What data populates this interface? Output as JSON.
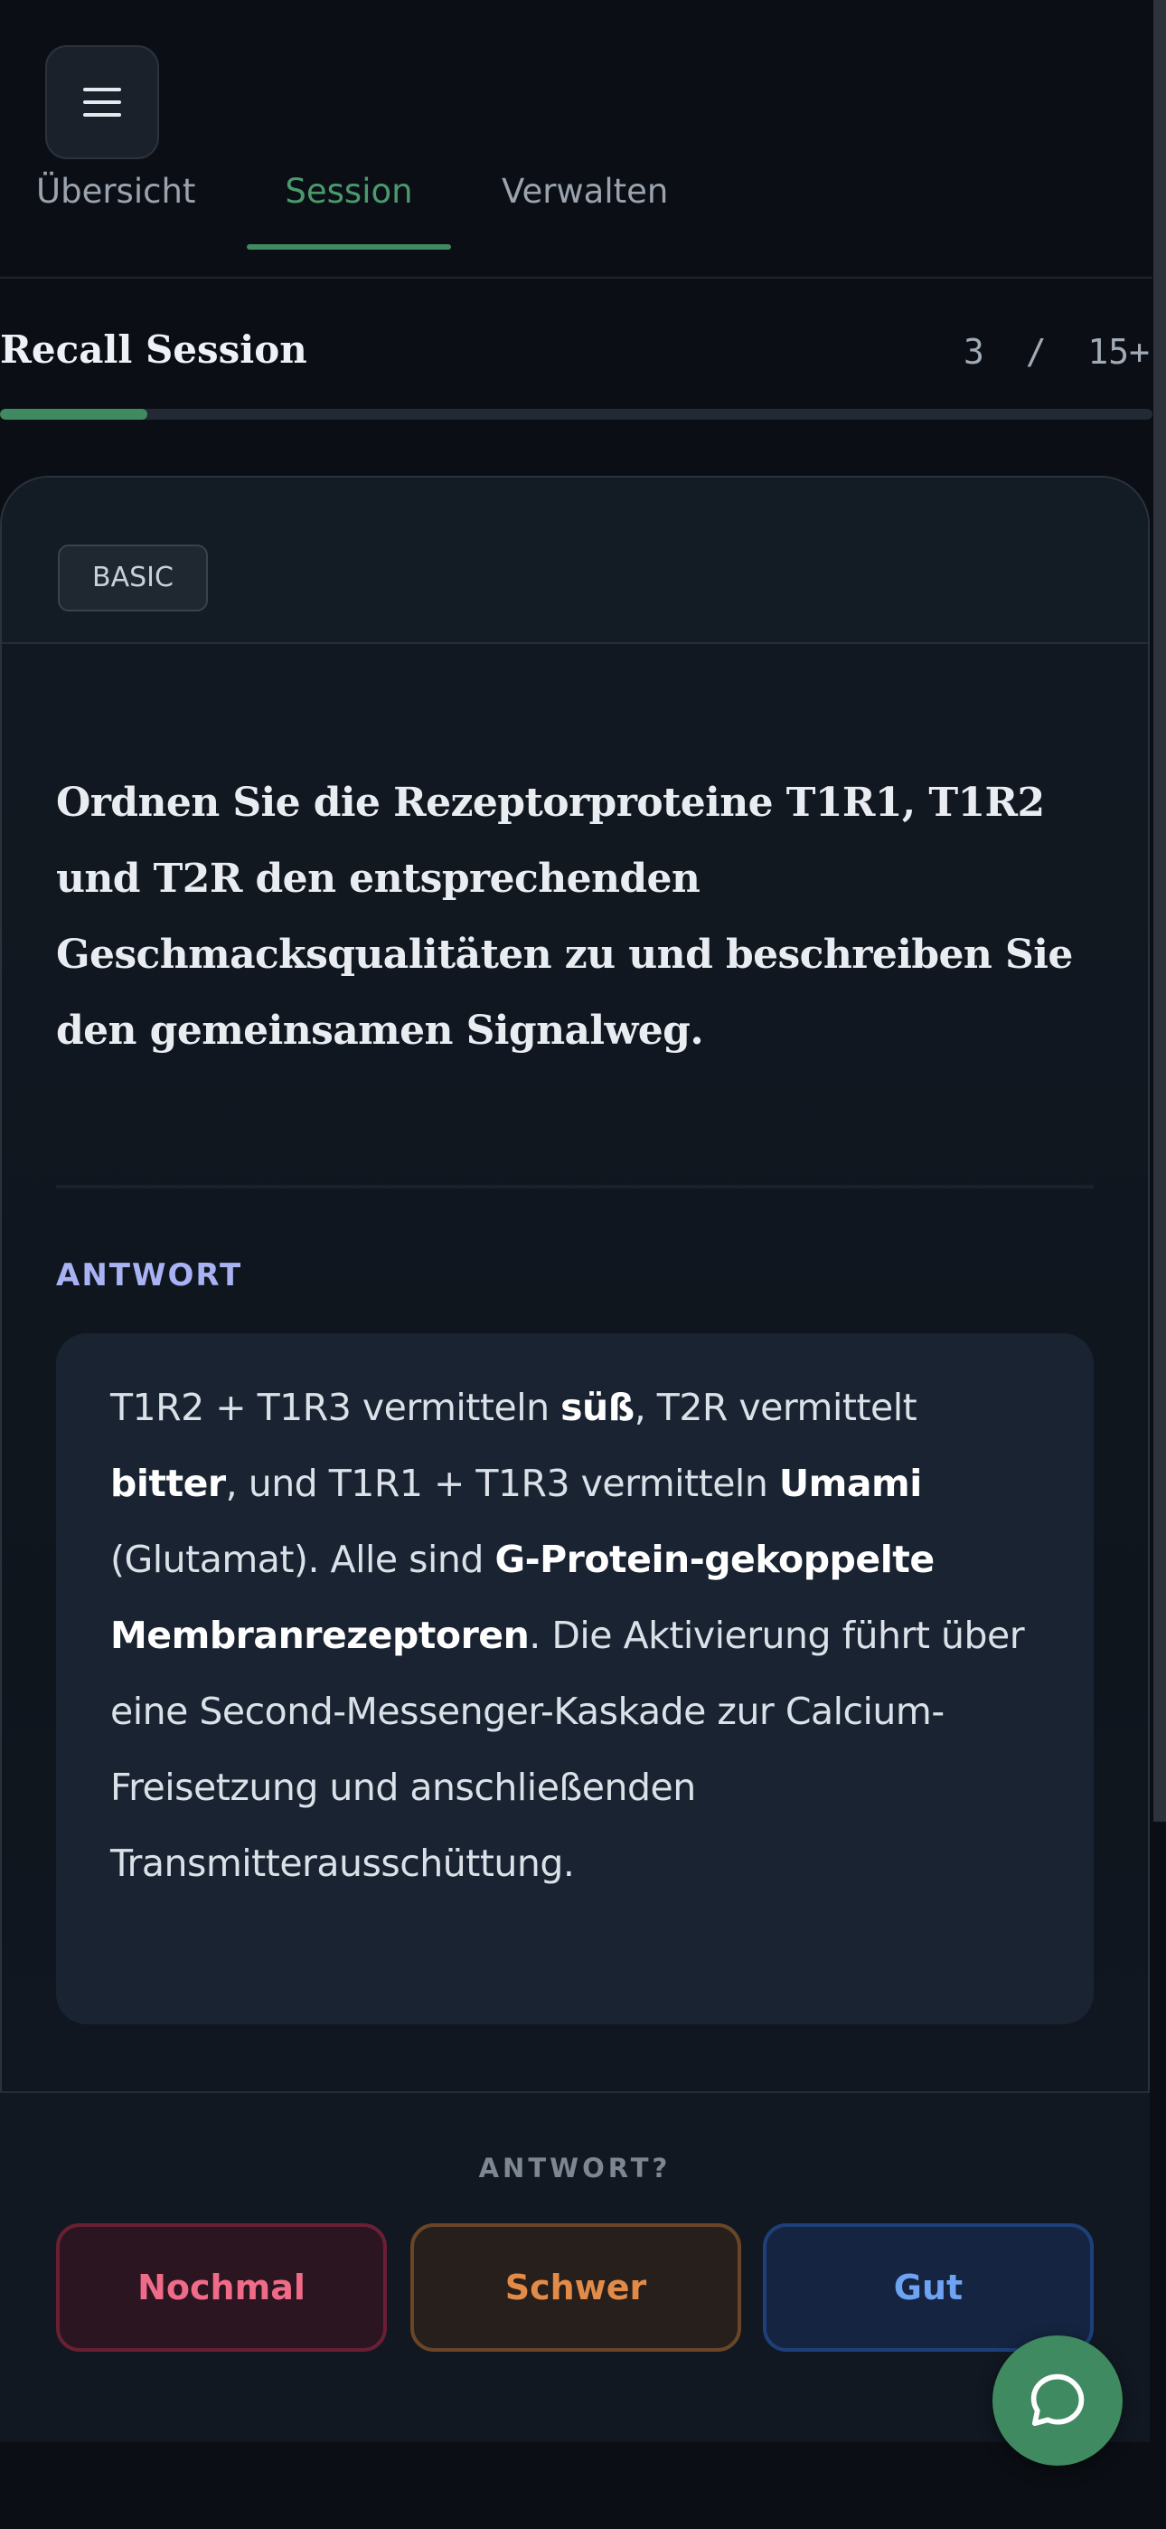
{
  "nav": {
    "menu_icon": "hamburger-menu-icon",
    "tabs": [
      {
        "label": "Übersicht",
        "active": false
      },
      {
        "label": "Session",
        "active": true
      },
      {
        "label": "Verwalten",
        "active": false
      }
    ]
  },
  "session": {
    "title": "Recall Session",
    "counter_current": "3",
    "counter_sep": "/",
    "counter_total": "15+",
    "progress": 0.128
  },
  "card": {
    "type_badge": "BASIC",
    "question": "Ordnen Sie die Rezeptorproteine T1R1, T1R2 und T2R den entsprechenden Geschmacksqualitäten zu und beschreiben Sie den gemeinsamen Signalweg.",
    "answer_label": "ANTWORT",
    "answer_segments": [
      {
        "text": "T1R2 + T1R3 vermitteln ",
        "bold": false
      },
      {
        "text": "süß",
        "bold": true
      },
      {
        "text": ", T2R vermittelt ",
        "bold": false
      },
      {
        "text": "bitter",
        "bold": true
      },
      {
        "text": ", und T1R1 + T1R3 vermitteln ",
        "bold": false
      },
      {
        "text": "Umami",
        "bold": true
      },
      {
        "text": " (Glutamat). Alle sind ",
        "bold": false
      },
      {
        "text": "G-Protein-gekoppelte Membranrezeptoren",
        "bold": true
      },
      {
        "text": ". Die Aktivierung führt über eine Second-Messenger-Kaskade zur Calcium-Freisetzung und anschließenden Transmitterausschüttung.",
        "bold": false
      }
    ]
  },
  "rating": {
    "prompt": "ANTWORT?",
    "again_label": "Nochmal",
    "hard_label": "Schwer",
    "good_label": "Gut"
  },
  "chat": {
    "icon": "chat-bubble-icon"
  },
  "colors": {
    "accent_green": "#3f8a60",
    "again_red": "#ef6b88",
    "hard_orange": "#e28b48",
    "good_blue": "#6ea2f2",
    "answer_label_purple": "#a9b2f3"
  }
}
